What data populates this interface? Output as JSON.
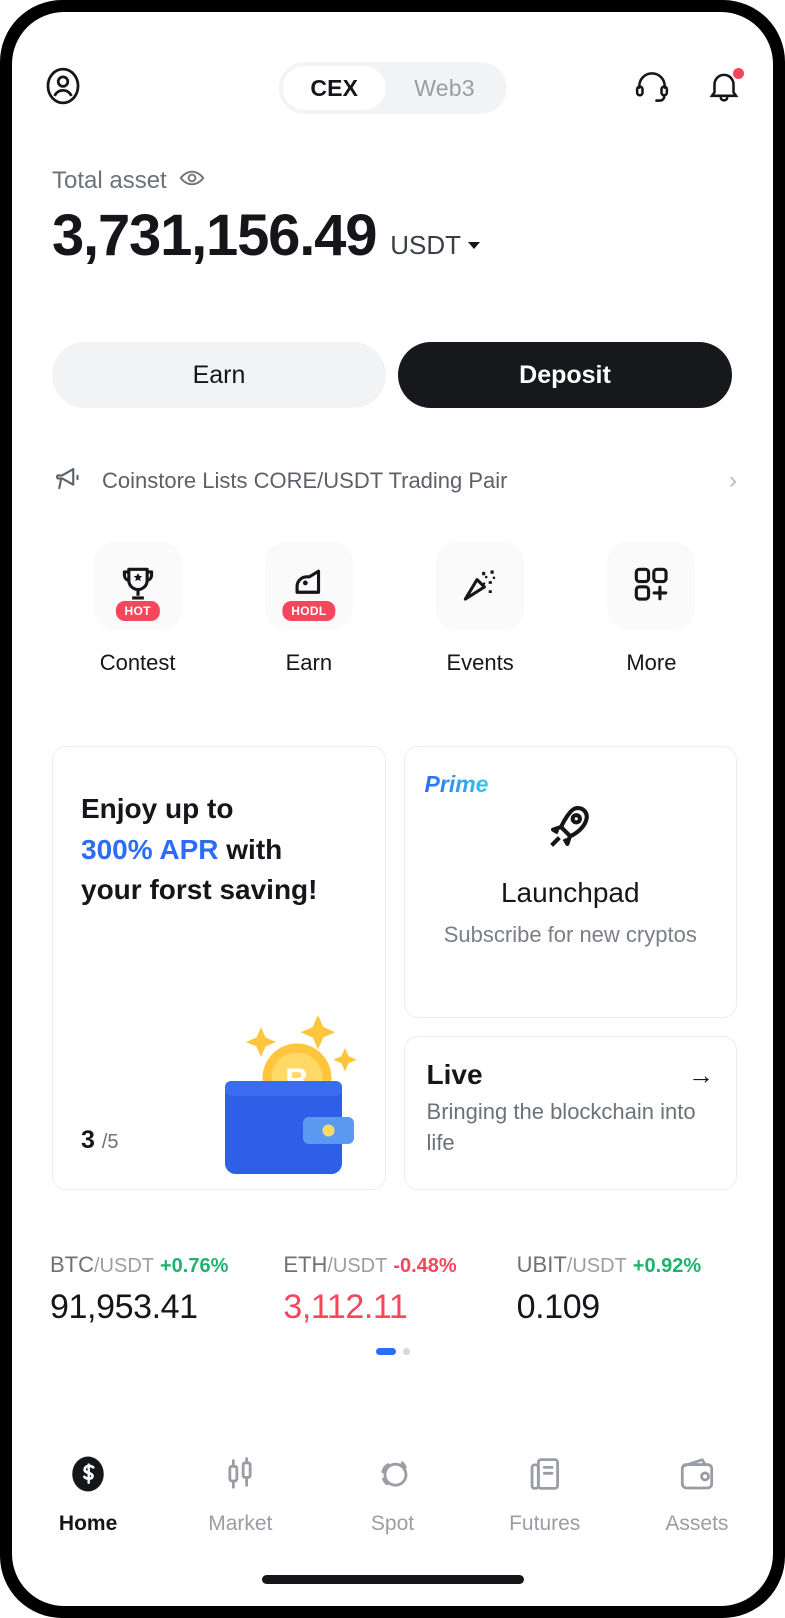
{
  "header": {
    "profile_icon": "user-circle-icon",
    "tabs": [
      {
        "label": "CEX",
        "active": true
      },
      {
        "label": "Web3",
        "active": false
      }
    ],
    "support_icon": "headset-icon",
    "notification_icon": "bell-icon",
    "notification_has_badge": true
  },
  "balance": {
    "label": "Total asset",
    "eye_icon": "eye-icon",
    "amount": "3,731,156.49",
    "currency": "USDT"
  },
  "actions": {
    "earn_label": "Earn",
    "deposit_label": "Deposit"
  },
  "announcement": {
    "icon": "megaphone-icon",
    "text": "Coinstore Lists CORE/USDT Trading Pair",
    "chevron": "chevron-right-icon"
  },
  "quick_actions": [
    {
      "label": "Contest",
      "icon": "trophy-icon",
      "badge": "HOT"
    },
    {
      "label": "Earn",
      "icon": "piggy-bank-icon",
      "badge": "HODL"
    },
    {
      "label": "Events",
      "icon": "confetti-icon",
      "badge": ""
    },
    {
      "label": "More",
      "icon": "grid-plus-icon",
      "badge": ""
    }
  ],
  "promo": {
    "savings": {
      "line1": "Enjoy up to",
      "highlight": "300% APR",
      "line2_rest": " with",
      "line3": "your forst saving!",
      "current": "3",
      "total": "/5",
      "art": "wallet-bitcoin-icon"
    },
    "prime": {
      "tag": "Prime",
      "icon": "rocket-icon",
      "title": "Launchpad",
      "subtitle": "Subscribe for new cryptos"
    },
    "live": {
      "title": "Live",
      "arrow_icon": "arrow-right-icon",
      "subtitle": "Bringing the blockchain into life"
    }
  },
  "tickers": [
    {
      "symbol": "BTC",
      "quote": "/USDT",
      "change": "+0.76%",
      "direction": "up",
      "price": "91,953.41",
      "price_color": "dark"
    },
    {
      "symbol": "ETH",
      "quote": "/USDT",
      "change": "-0.48%",
      "direction": "down",
      "price": "3,112.11",
      "price_color": "red"
    },
    {
      "symbol": "UBIT",
      "quote": "/USDT",
      "change": "+0.92%",
      "direction": "up",
      "price": "0.109",
      "price_color": "dark"
    }
  ],
  "carousel_dots": {
    "count": 2,
    "active_index": 0
  },
  "bottom_nav": [
    {
      "label": "Home",
      "icon": "home-logo-icon",
      "active": true
    },
    {
      "label": "Market",
      "icon": "candlestick-icon",
      "active": false
    },
    {
      "label": "Spot",
      "icon": "spot-swap-icon",
      "active": false
    },
    {
      "label": "Futures",
      "icon": "futures-doc-icon",
      "active": false
    },
    {
      "label": "Assets",
      "icon": "wallet-icon",
      "active": false
    }
  ],
  "colors": {
    "accent_blue": "#2b6df6",
    "up_green": "#20b26c",
    "down_red": "#f5465c",
    "dark": "#16181c"
  }
}
